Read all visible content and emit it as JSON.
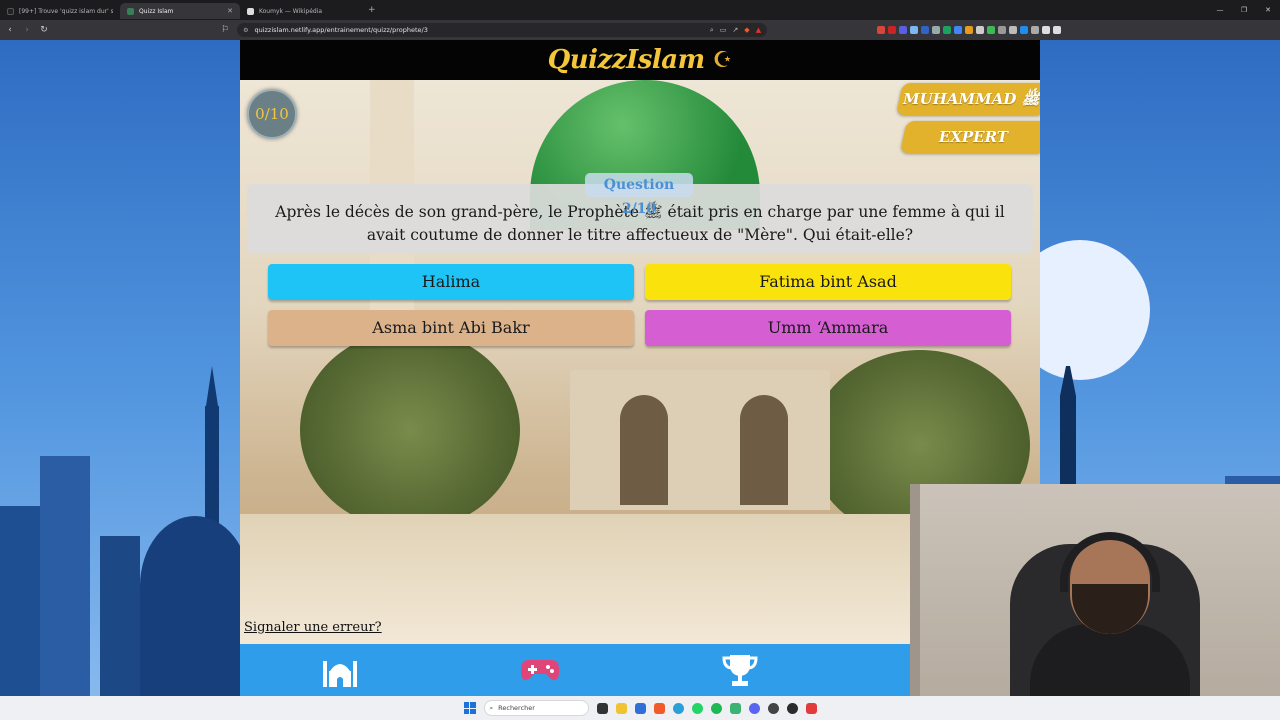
{
  "browser": {
    "tabs": [
      {
        "label": "[99+] Trouve 'quizz islam dur' sur Tik...",
        "active": false
      },
      {
        "label": "Quizz Islam",
        "active": true
      },
      {
        "label": "Koumyk — Wikipédia",
        "active": false
      }
    ],
    "url": "quizzislam.netlify.app/entrainement/quizz/prophete/3"
  },
  "app": {
    "logo": "QuizzIslam",
    "score": "0/10",
    "category": "MUHAMMAD ﷺ",
    "level": "EXPERT",
    "question_counter": "Question 2/10",
    "question": "Après le décès de son grand-père, le Prophète ﷺ était pris en charge par une femme à qui il avait coutume de donner le titre affectueux de \"Mère\". Qui était-elle?",
    "answers": [
      {
        "label": "Halima",
        "color": "#1ec4f5"
      },
      {
        "label": "Fatima bint Asad",
        "color": "#fae30d"
      },
      {
        "label": "Asma bint Abi Bakr",
        "color": "#dcb28a"
      },
      {
        "label": "Umm ‘Ammara",
        "color": "#d45ed2"
      }
    ],
    "report_link": "Signaler une erreur?",
    "bottom_nav": [
      {
        "icon": "mosque-icon"
      },
      {
        "icon": "gamepad-icon"
      },
      {
        "icon": "trophy-icon"
      },
      {
        "icon": "podium-icon"
      }
    ]
  },
  "taskbar": {
    "search_placeholder": "Rechercher"
  },
  "colors": {
    "accent_gold": "#e2b22c",
    "nav_blue": "#2f9de9"
  }
}
